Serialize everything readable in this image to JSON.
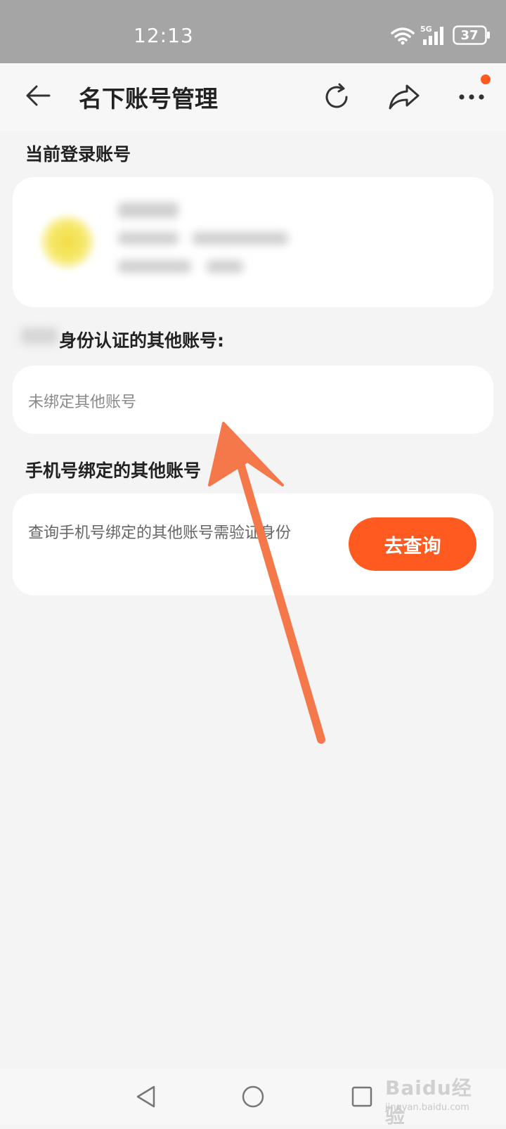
{
  "status_bar": {
    "time": "12:13",
    "network": "5G",
    "battery": "37"
  },
  "app_bar": {
    "title": "名下账号管理",
    "icons": {
      "back": "back-arrow-icon",
      "refresh": "refresh-icon",
      "share": "share-icon",
      "more": "more-dots-icon"
    },
    "notification_dot_color": "#ff5a1f"
  },
  "sections": {
    "current_login": {
      "label": "当前登录账号"
    },
    "other_accounts": {
      "label": "身份认证的其他账号:",
      "empty_text": "未绑定其他账号"
    },
    "phone_accounts": {
      "label": "手机号绑定的其他账号",
      "description": "查询手机号绑定的其他账号需验证身份",
      "button_label": "去查询"
    }
  },
  "colors": {
    "accent": "#ff5a1f",
    "background": "#f4f4f4",
    "card": "#ffffff",
    "annotation_arrow": "#f4784a"
  },
  "watermark": {
    "main": "Baidu经验",
    "sub": "jingyan.baidu.com"
  }
}
